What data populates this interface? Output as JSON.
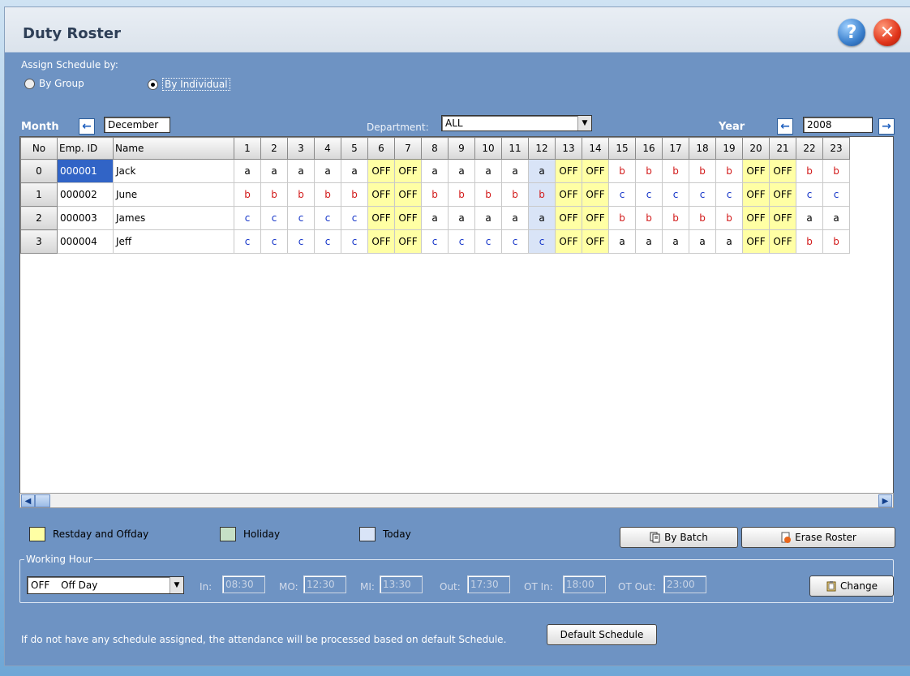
{
  "window": {
    "title": "Duty Roster",
    "help_label": "?",
    "close_label": "✕"
  },
  "assign": {
    "label": "Assign Schedule by:",
    "by_group": "By Group",
    "by_individual": "By Individual",
    "selected": "By Individual"
  },
  "month": {
    "label": "Month",
    "value": "December"
  },
  "department": {
    "label": "Department:",
    "value": "ALL"
  },
  "year": {
    "label": "Year",
    "value": "2008"
  },
  "grid": {
    "columns": [
      "No",
      "Emp. ID",
      "Name",
      "1",
      "2",
      "3",
      "4",
      "5",
      "6",
      "7",
      "8",
      "9",
      "10",
      "11",
      "12",
      "13",
      "14",
      "15",
      "16",
      "17",
      "18",
      "19",
      "20",
      "21",
      "22",
      "23"
    ],
    "rows": [
      {
        "no": "0",
        "id": "000001",
        "name": "Jack",
        "days": [
          "a",
          "a",
          "a",
          "a",
          "a",
          "OFF",
          "OFF",
          "a",
          "a",
          "a",
          "a",
          "a",
          "OFF",
          "OFF",
          "b",
          "b",
          "b",
          "b",
          "b",
          "OFF",
          "OFF",
          "b",
          "b"
        ]
      },
      {
        "no": "1",
        "id": "000002",
        "name": "June",
        "days": [
          "b",
          "b",
          "b",
          "b",
          "b",
          "OFF",
          "OFF",
          "b",
          "b",
          "b",
          "b",
          "b",
          "OFF",
          "OFF",
          "c",
          "c",
          "c",
          "c",
          "c",
          "OFF",
          "OFF",
          "c",
          "c"
        ]
      },
      {
        "no": "2",
        "id": "000003",
        "name": "James",
        "days": [
          "c",
          "c",
          "c",
          "c",
          "c",
          "OFF",
          "OFF",
          "a",
          "a",
          "a",
          "a",
          "a",
          "OFF",
          "OFF",
          "b",
          "b",
          "b",
          "b",
          "b",
          "OFF",
          "OFF",
          "a",
          "a"
        ]
      },
      {
        "no": "3",
        "id": "000004",
        "name": "Jeff",
        "days": [
          "c",
          "c",
          "c",
          "c",
          "c",
          "OFF",
          "OFF",
          "c",
          "c",
          "c",
          "c",
          "c",
          "OFF",
          "OFF",
          "a",
          "a",
          "a",
          "a",
          "a",
          "OFF",
          "OFF",
          "b",
          "b"
        ]
      }
    ],
    "today_column": "12",
    "selected_cell": "000001"
  },
  "legend": {
    "restday": "Restday and Offday",
    "holiday": "Holiday",
    "today": "Today",
    "colors": {
      "restday": "#ffffa4",
      "holiday": "#c6e0c6",
      "today": "#d9e4f7"
    }
  },
  "buttons": {
    "by_batch": "By Batch",
    "erase_roster": "Erase Roster",
    "change": "Change",
    "default_schedule": "Default Schedule"
  },
  "working_hour": {
    "title": "Working Hour",
    "shift_code": "OFF",
    "shift_name": "Off Day",
    "in_label": "In:",
    "in_value": "08:30",
    "mo_label": "MO:",
    "mo_value": "12:30",
    "mi_label": "MI:",
    "mi_value": "13:30",
    "out_label": "Out:",
    "out_value": "17:30",
    "otin_label": "OT In:",
    "otin_value": "18:00",
    "otout_label": "OT Out:",
    "otout_value": "23:00"
  },
  "footer": {
    "note": "If do not have any schedule assigned, the attendance will be processed based on default Schedule."
  }
}
